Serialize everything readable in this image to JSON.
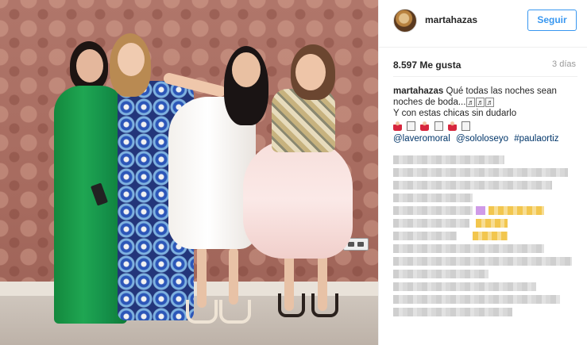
{
  "post": {
    "username": "martahazas",
    "follow_label": "Seguir",
    "likes_text": "8.597 Me gusta",
    "time_ago": "3 días",
    "caption": {
      "user": "martahazas",
      "line1_text": "Qué todas las noches sean",
      "line2_text": "noches de boda...",
      "line2_symbols": [
        "♬",
        "♬",
        "♬"
      ],
      "line3_text": "Y con estas chicas sin dudarlo",
      "emoji_row": [
        "dancer-emoji",
        "box-emoji",
        "dancer-emoji",
        "box-emoji",
        "dancer-emoji",
        "box-emoji"
      ],
      "mentions": [
        "@laveromoral",
        "@sololoseyo",
        "#paulaortiz"
      ]
    }
  },
  "colors": {
    "follow_blue": "#3897f0",
    "mention_blue": "#003569",
    "text_dark": "#262626",
    "meta_gray": "#999999",
    "dress_green": "#1fa652",
    "dress_blue": "#23357a",
    "dress_pink": "#f7dfdb"
  },
  "icons": {
    "avatar": "profile-photo",
    "notes": "music-note-icon"
  }
}
